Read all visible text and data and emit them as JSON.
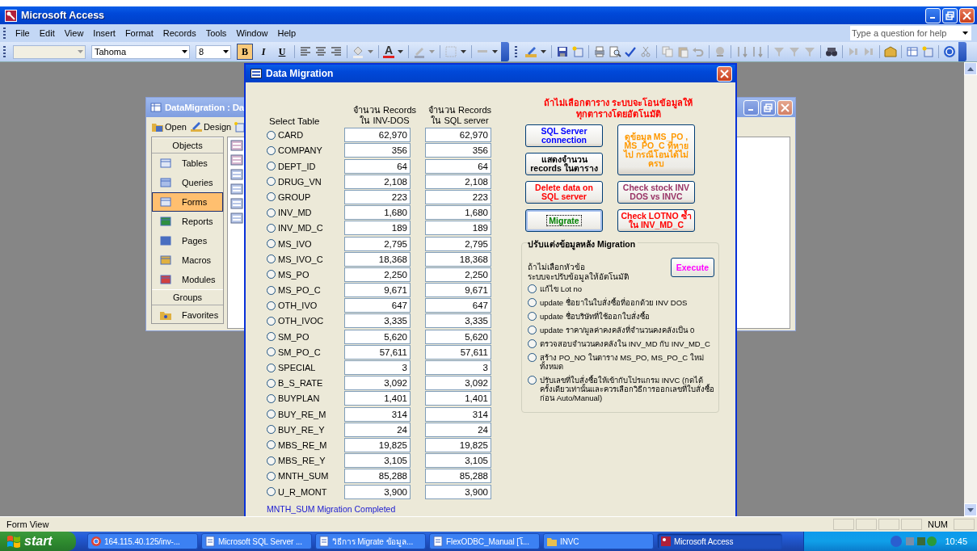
{
  "app_title": "Microsoft Access",
  "menu": [
    "File",
    "Edit",
    "View",
    "Insert",
    "Format",
    "Records",
    "Tools",
    "Window",
    "Help"
  ],
  "help_box": {
    "placeholder": "Type a question for help"
  },
  "toolbar": {
    "font": "Tahoma",
    "size": "8",
    "font_color_label": "A",
    "format_buttons": [
      {
        "label": "B",
        "selected": true
      },
      {
        "label": "I",
        "selected": false
      },
      {
        "label": "U",
        "selected": false
      }
    ]
  },
  "database_window": {
    "title": "DataMigration : Da",
    "tools": [
      "Open",
      "Design"
    ],
    "objects_header": "Objects",
    "objects": [
      {
        "label": "Tables",
        "selected": false
      },
      {
        "label": "Queries",
        "selected": false
      },
      {
        "label": "Forms",
        "selected": true
      },
      {
        "label": "Reports",
        "selected": false
      },
      {
        "label": "Pages",
        "selected": false
      },
      {
        "label": "Macros",
        "selected": false
      },
      {
        "label": "Modules",
        "selected": false
      }
    ],
    "groups_header": "Groups",
    "groups": [
      "Favorites"
    ]
  },
  "form": {
    "title": "Data Migration",
    "select_label": "Select Table",
    "column_headers": [
      "จำนวน Records\nใน INV-DOS",
      "จำนวน Records\nใน SQL server"
    ],
    "tables": [
      {
        "name": "CARD",
        "inv_dos": "62,970",
        "sql": "62,970",
        "selected": false
      },
      {
        "name": "COMPANY",
        "inv_dos": "356",
        "sql": "356",
        "selected": false
      },
      {
        "name": "DEPT_ID",
        "inv_dos": "64",
        "sql": "64",
        "selected": false
      },
      {
        "name": "DRUG_VN",
        "inv_dos": "2,108",
        "sql": "2,108",
        "selected": false
      },
      {
        "name": "GROUP",
        "inv_dos": "223",
        "sql": "223",
        "selected": false
      },
      {
        "name": "INV_MD",
        "inv_dos": "1,680",
        "sql": "1,680",
        "selected": false
      },
      {
        "name": "INV_MD_C",
        "inv_dos": "189",
        "sql": "189",
        "selected": false
      },
      {
        "name": "MS_IVO",
        "inv_dos": "2,795",
        "sql": "2,795",
        "selected": false
      },
      {
        "name": "MS_IVO_C",
        "inv_dos": "18,368",
        "sql": "18,368",
        "selected": false
      },
      {
        "name": "MS_PO",
        "inv_dos": "2,250",
        "sql": "2,250",
        "selected": false
      },
      {
        "name": "MS_PO_C",
        "inv_dos": "9,671",
        "sql": "9,671",
        "selected": false
      },
      {
        "name": "OTH_IVO",
        "inv_dos": "647",
        "sql": "647",
        "selected": false
      },
      {
        "name": "OTH_IVOC",
        "inv_dos": "3,335",
        "sql": "3,335",
        "selected": false
      },
      {
        "name": "SM_PO",
        "inv_dos": "5,620",
        "sql": "5,620",
        "selected": false
      },
      {
        "name": "SM_PO_C",
        "inv_dos": "57,611",
        "sql": "57,611",
        "selected": false
      },
      {
        "name": "SPECIAL",
        "inv_dos": "3",
        "sql": "3",
        "selected": false
      },
      {
        "name": "B_S_RATE",
        "inv_dos": "3,092",
        "sql": "3,092",
        "selected": false
      },
      {
        "name": "BUYPLAN",
        "inv_dos": "1,401",
        "sql": "1,401",
        "selected": false
      },
      {
        "name": "BUY_RE_M",
        "inv_dos": "314",
        "sql": "314",
        "selected": false
      },
      {
        "name": "BUY_RE_Y",
        "inv_dos": "24",
        "sql": "24",
        "selected": false
      },
      {
        "name": "MBS_RE_M",
        "inv_dos": "19,825",
        "sql": "19,825",
        "selected": false
      },
      {
        "name": "MBS_RE_Y",
        "inv_dos": "3,105",
        "sql": "3,105",
        "selected": false
      },
      {
        "name": "MNTH_SUM",
        "inv_dos": "85,288",
        "sql": "85,288",
        "selected": false
      },
      {
        "name": "U_R_MONT",
        "inv_dos": "3,900",
        "sql": "3,900",
        "selected": false
      }
    ],
    "notice": "ถ้าไม่เลือกตาราง ระบบจะโอนข้อมูลให้\nทุกตารางโดยอัตโนมัติ",
    "left_buttons": [
      {
        "label": "SQL Server connection",
        "color": "#0000ff",
        "focused": false
      },
      {
        "label": "แสดงจำนวน records ในตาราง",
        "color": "#000000",
        "focused": false
      },
      {
        "label": "Delete data on SQL server",
        "color": "#ff0000",
        "focused": false
      },
      {
        "label": "Migrate",
        "color": "#008000",
        "focused": true
      }
    ],
    "right_buttons": [
      {
        "label": "ดูข้อมูล MS_PO , MS_PO_C ที่หายไป กรณีโอนได้ไม่ครบ",
        "color": "#ff9900",
        "focused": false
      },
      {
        "label": "Check stock INV DOS vs INVC",
        "color": "#993366",
        "focused": false
      },
      {
        "label": "Check  LOTNO ซ้ำ ใน INV_MD_C",
        "color": "#ff0000",
        "focused": false
      }
    ],
    "adjust": {
      "title": "ปรับแต่งข้อมูลหลัง Migration",
      "hint": "ถ้าไม่เลือกหัวข้อ\nระบบจะปรับข้อมูลให้อัตโนมัติ",
      "execute": "Execute",
      "options": [
        {
          "label": "แก้ไข Lot no",
          "selected": false
        },
        {
          "label": "update ชื่อยาในใบสั่งซื้อที่ออกด้วย INV DOS",
          "selected": false
        },
        {
          "label": "update ชื่อบริษัทที่ใช้ออกใบสั่งซื้อ",
          "selected": false
        },
        {
          "label": "update ราคา/มูลค่าคงคลังที่จำนวนคงคลังเป็น 0",
          "selected": false
        },
        {
          "label": "ตรวจสอบจำนวนคงคลังใน INV_MD กับ INV_MD_C",
          "selected": false
        },
        {
          "label": "สร้าง PO_NO ในตาราง MS_PO, MS_PO_C ใหม่ทั้งหมด",
          "selected": false
        },
        {
          "label": "ปรับเลขที่ใบสั่งซื้อให้เข้ากับโปรแกรม INVC (กดได้ครั้งเดียวเท่านั้นและควรเลือกวิธีการออกเลขที่ใบสั่งซื้อก่อน Auto/Manual)",
          "selected": false
        }
      ]
    },
    "status_message": "MNTH_SUM Migration Completed"
  },
  "status_bar": {
    "text": "Form View",
    "num": "NUM"
  },
  "taskbar": {
    "start": "start",
    "clock": "10:45",
    "items": [
      {
        "label": "164.115.40.125/inv-...",
        "selected": false
      },
      {
        "label": "Microsoft SQL Server ...",
        "selected": false
      },
      {
        "label": "วิธีการ Migrate ข้อมูล...",
        "selected": false
      },
      {
        "label": "FlexODBC_Manual [โ...",
        "selected": false
      },
      {
        "label": "INVC",
        "selected": false
      },
      {
        "label": "Microsoft Access",
        "selected": true
      }
    ]
  }
}
